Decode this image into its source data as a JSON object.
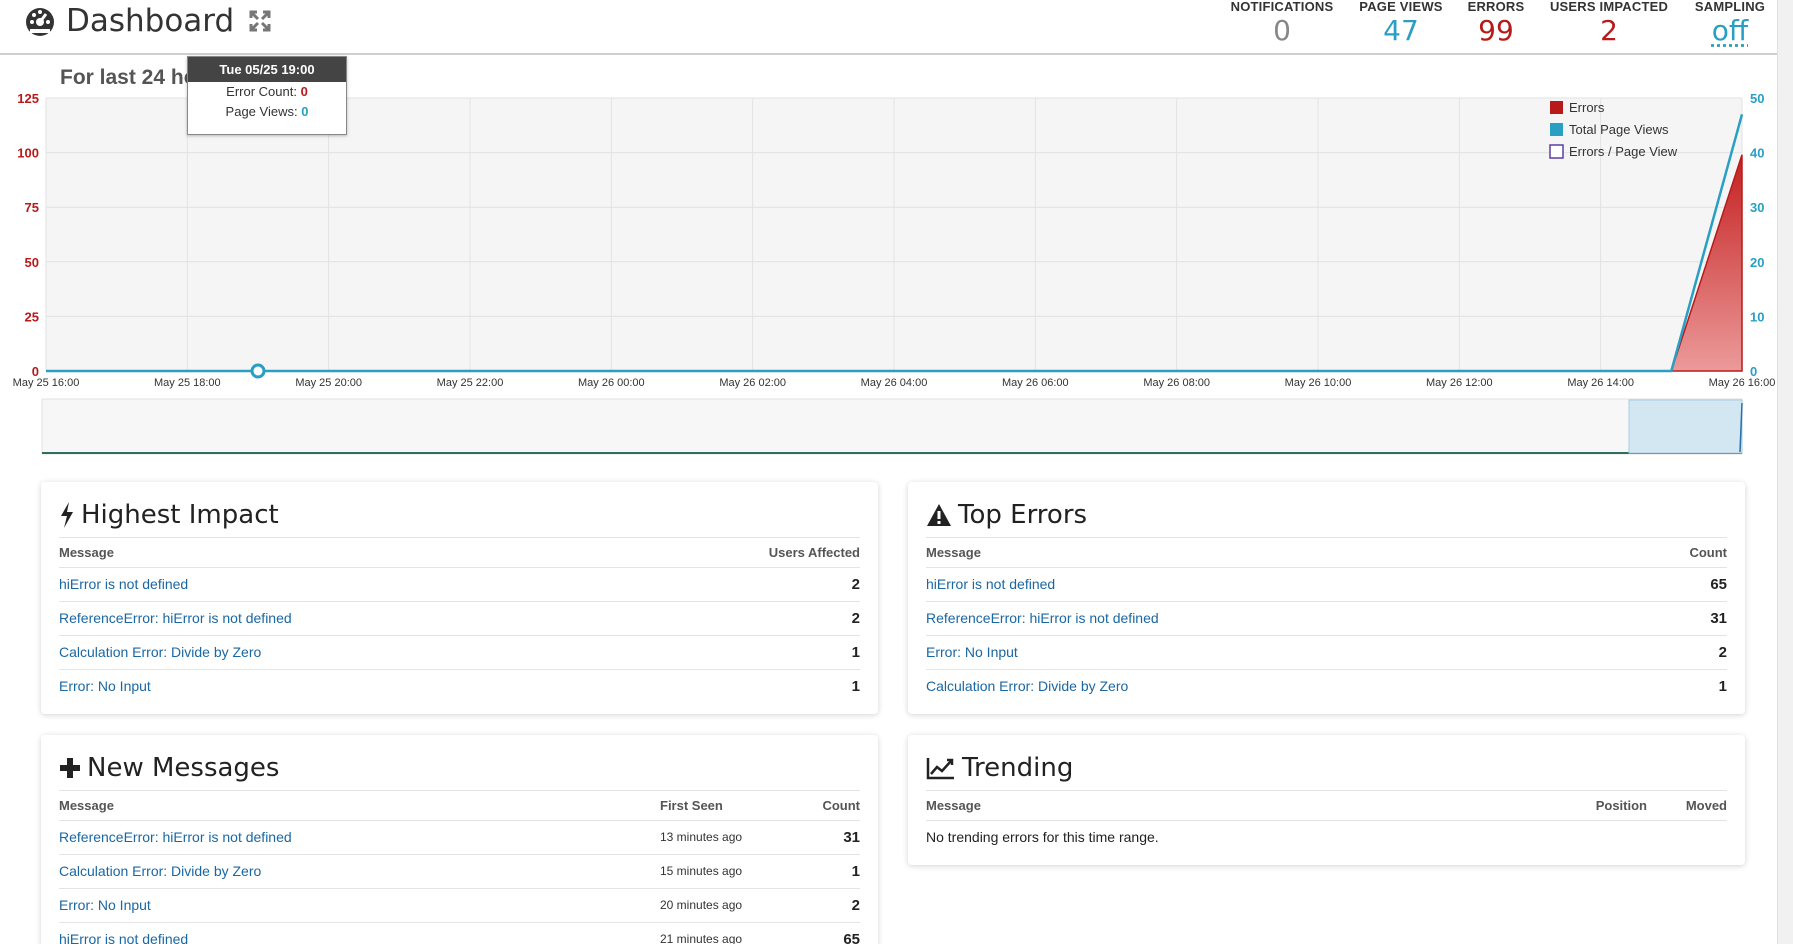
{
  "header": {
    "title": "Dashboard",
    "stats": [
      {
        "label": "NOTIFICATIONS",
        "value": "0",
        "color": "#888888"
      },
      {
        "label": "PAGE VIEWS",
        "value": "47",
        "color": "#2a9fc4"
      },
      {
        "label": "ERRORS",
        "value": "99",
        "color": "#b81a1a"
      },
      {
        "label": "USERS IMPACTED",
        "value": "2",
        "color": "#b81a1a"
      },
      {
        "label": "SAMPLING",
        "value": "off",
        "color": "#2a9fc4"
      }
    ]
  },
  "range_label": "For last 24 hours",
  "tooltip": {
    "title": "Tue 05/25 19:00",
    "error_label": "Error Count:",
    "error_value": "0",
    "views_label": "Page Views:",
    "views_value": "0"
  },
  "chart_data": {
    "type": "area",
    "x_labels": [
      "May 25 16:00",
      "May 25 18:00",
      "May 25 20:00",
      "May 25 22:00",
      "May 26 00:00",
      "May 26 02:00",
      "May 26 04:00",
      "May 26 06:00",
      "May 26 08:00",
      "May 26 10:00",
      "May 26 12:00",
      "May 26 14:00",
      "May 26 16:00"
    ],
    "x_hours": [
      0,
      23,
      24
    ],
    "left_axis": {
      "ticks": [
        "0",
        "25",
        "50",
        "75",
        "100",
        "125"
      ],
      "ylim": [
        0,
        125
      ],
      "color": "#b81a1a"
    },
    "right_axis": {
      "ticks": [
        "0",
        "10",
        "20",
        "30",
        "40",
        "50"
      ],
      "ylim": [
        0,
        50
      ],
      "color": "#2a9fc4"
    },
    "grid": true,
    "legend_position": "top-right",
    "series": [
      {
        "name": "Errors",
        "axis": "left",
        "values": [
          0,
          0,
          99
        ],
        "color": "#b81a1a"
      },
      {
        "name": "Total Page Views",
        "axis": "right",
        "values": [
          0,
          0,
          47
        ],
        "color": "#2a9fc4"
      },
      {
        "name": "Errors / Page View",
        "axis": "right",
        "values": [],
        "color": "#5b3fa8"
      }
    ],
    "tooltip_x_hour": 3
  },
  "panels": {
    "impact": {
      "title": "Highest Impact",
      "columns": [
        "Message",
        "Users Affected"
      ],
      "rows": [
        {
          "message": "hiError is not defined",
          "count": "2"
        },
        {
          "message": "ReferenceError: hiError is not defined",
          "count": "2"
        },
        {
          "message": "Calculation Error: Divide by Zero",
          "count": "1"
        },
        {
          "message": "Error: No Input",
          "count": "1"
        }
      ]
    },
    "top": {
      "title": "Top Errors",
      "columns": [
        "Message",
        "Count"
      ],
      "rows": [
        {
          "message": "hiError is not defined",
          "count": "65"
        },
        {
          "message": "ReferenceError: hiError is not defined",
          "count": "31"
        },
        {
          "message": "Error: No Input",
          "count": "2"
        },
        {
          "message": "Calculation Error: Divide by Zero",
          "count": "1"
        }
      ]
    },
    "new": {
      "title": "New Messages",
      "columns": [
        "Message",
        "First Seen",
        "Count"
      ],
      "rows": [
        {
          "message": "ReferenceError: hiError is not defined",
          "seen": "13 minutes ago",
          "count": "31"
        },
        {
          "message": "Calculation Error: Divide by Zero",
          "seen": "15 minutes ago",
          "count": "1"
        },
        {
          "message": "Error: No Input",
          "seen": "20 minutes ago",
          "count": "2"
        },
        {
          "message": "hiError is not defined",
          "seen": "21 minutes ago",
          "count": "65"
        }
      ]
    },
    "trend": {
      "title": "Trending",
      "columns": [
        "Message",
        "Position",
        "Moved"
      ],
      "empty": "No trending errors for this time range."
    }
  }
}
